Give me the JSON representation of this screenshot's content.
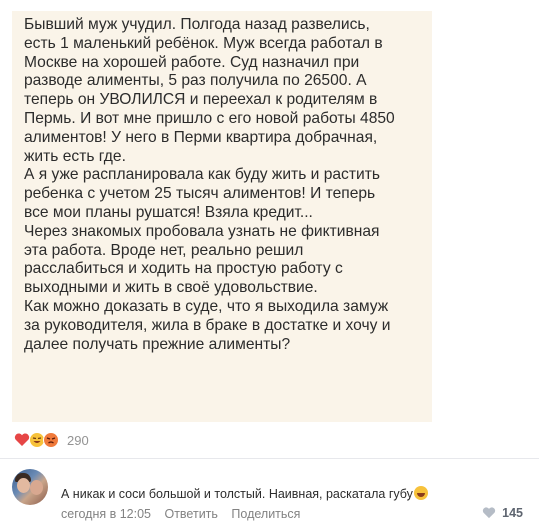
{
  "post": {
    "text_lines": [
      "Бывший муж учудил. Полгода назад развелись,",
      "есть 1 маленький ребёнок. Муж всегда работал в",
      "Москве на хорошей работе. Суд назначил при",
      "разводе алименты, 5 раз получила по 26500. А",
      "теперь он УВОЛИЛСЯ и переехал к родителям в",
      "Пермь. И вот мне пришло с его новой работы 4850",
      "алиментов! У него в Перми квартира добрачная,",
      "жить есть где.",
      "А я уже распланировала как буду жить и растить",
      "ребенка с учетом 25 тысяч алиментов! И теперь",
      "все мои планы рушатся! Взяла кредит...",
      "Через знакомых пробовала узнать не фиктивная",
      "эта работа. Вроде нет, реально решил",
      "расслабиться и ходить на простую работу с",
      "выходными и жить в своё удовольствие.",
      "Как можно доказать в суде, что я выходила замуж",
      "за руководителя, жила в браке в достатке и хочу и",
      "далее получать прежние алименты?"
    ]
  },
  "reactions": {
    "icons": [
      "heart-icon",
      "laugh-icon",
      "angry-icon"
    ],
    "count": "290"
  },
  "comment": {
    "text": "А никак и соси большой и толстый. Наивная, раскатала губу",
    "emoji": "rofl-emoji",
    "time": "сегодня в 12:05",
    "reply_label": "Ответить",
    "share_label": "Поделиться",
    "likes": "145"
  },
  "colors": {
    "card_bg": "#faf4e9",
    "heart": "#e64646",
    "laugh": "#f7c23b",
    "angry": "#f07a3b",
    "meta_text": "#828282"
  }
}
